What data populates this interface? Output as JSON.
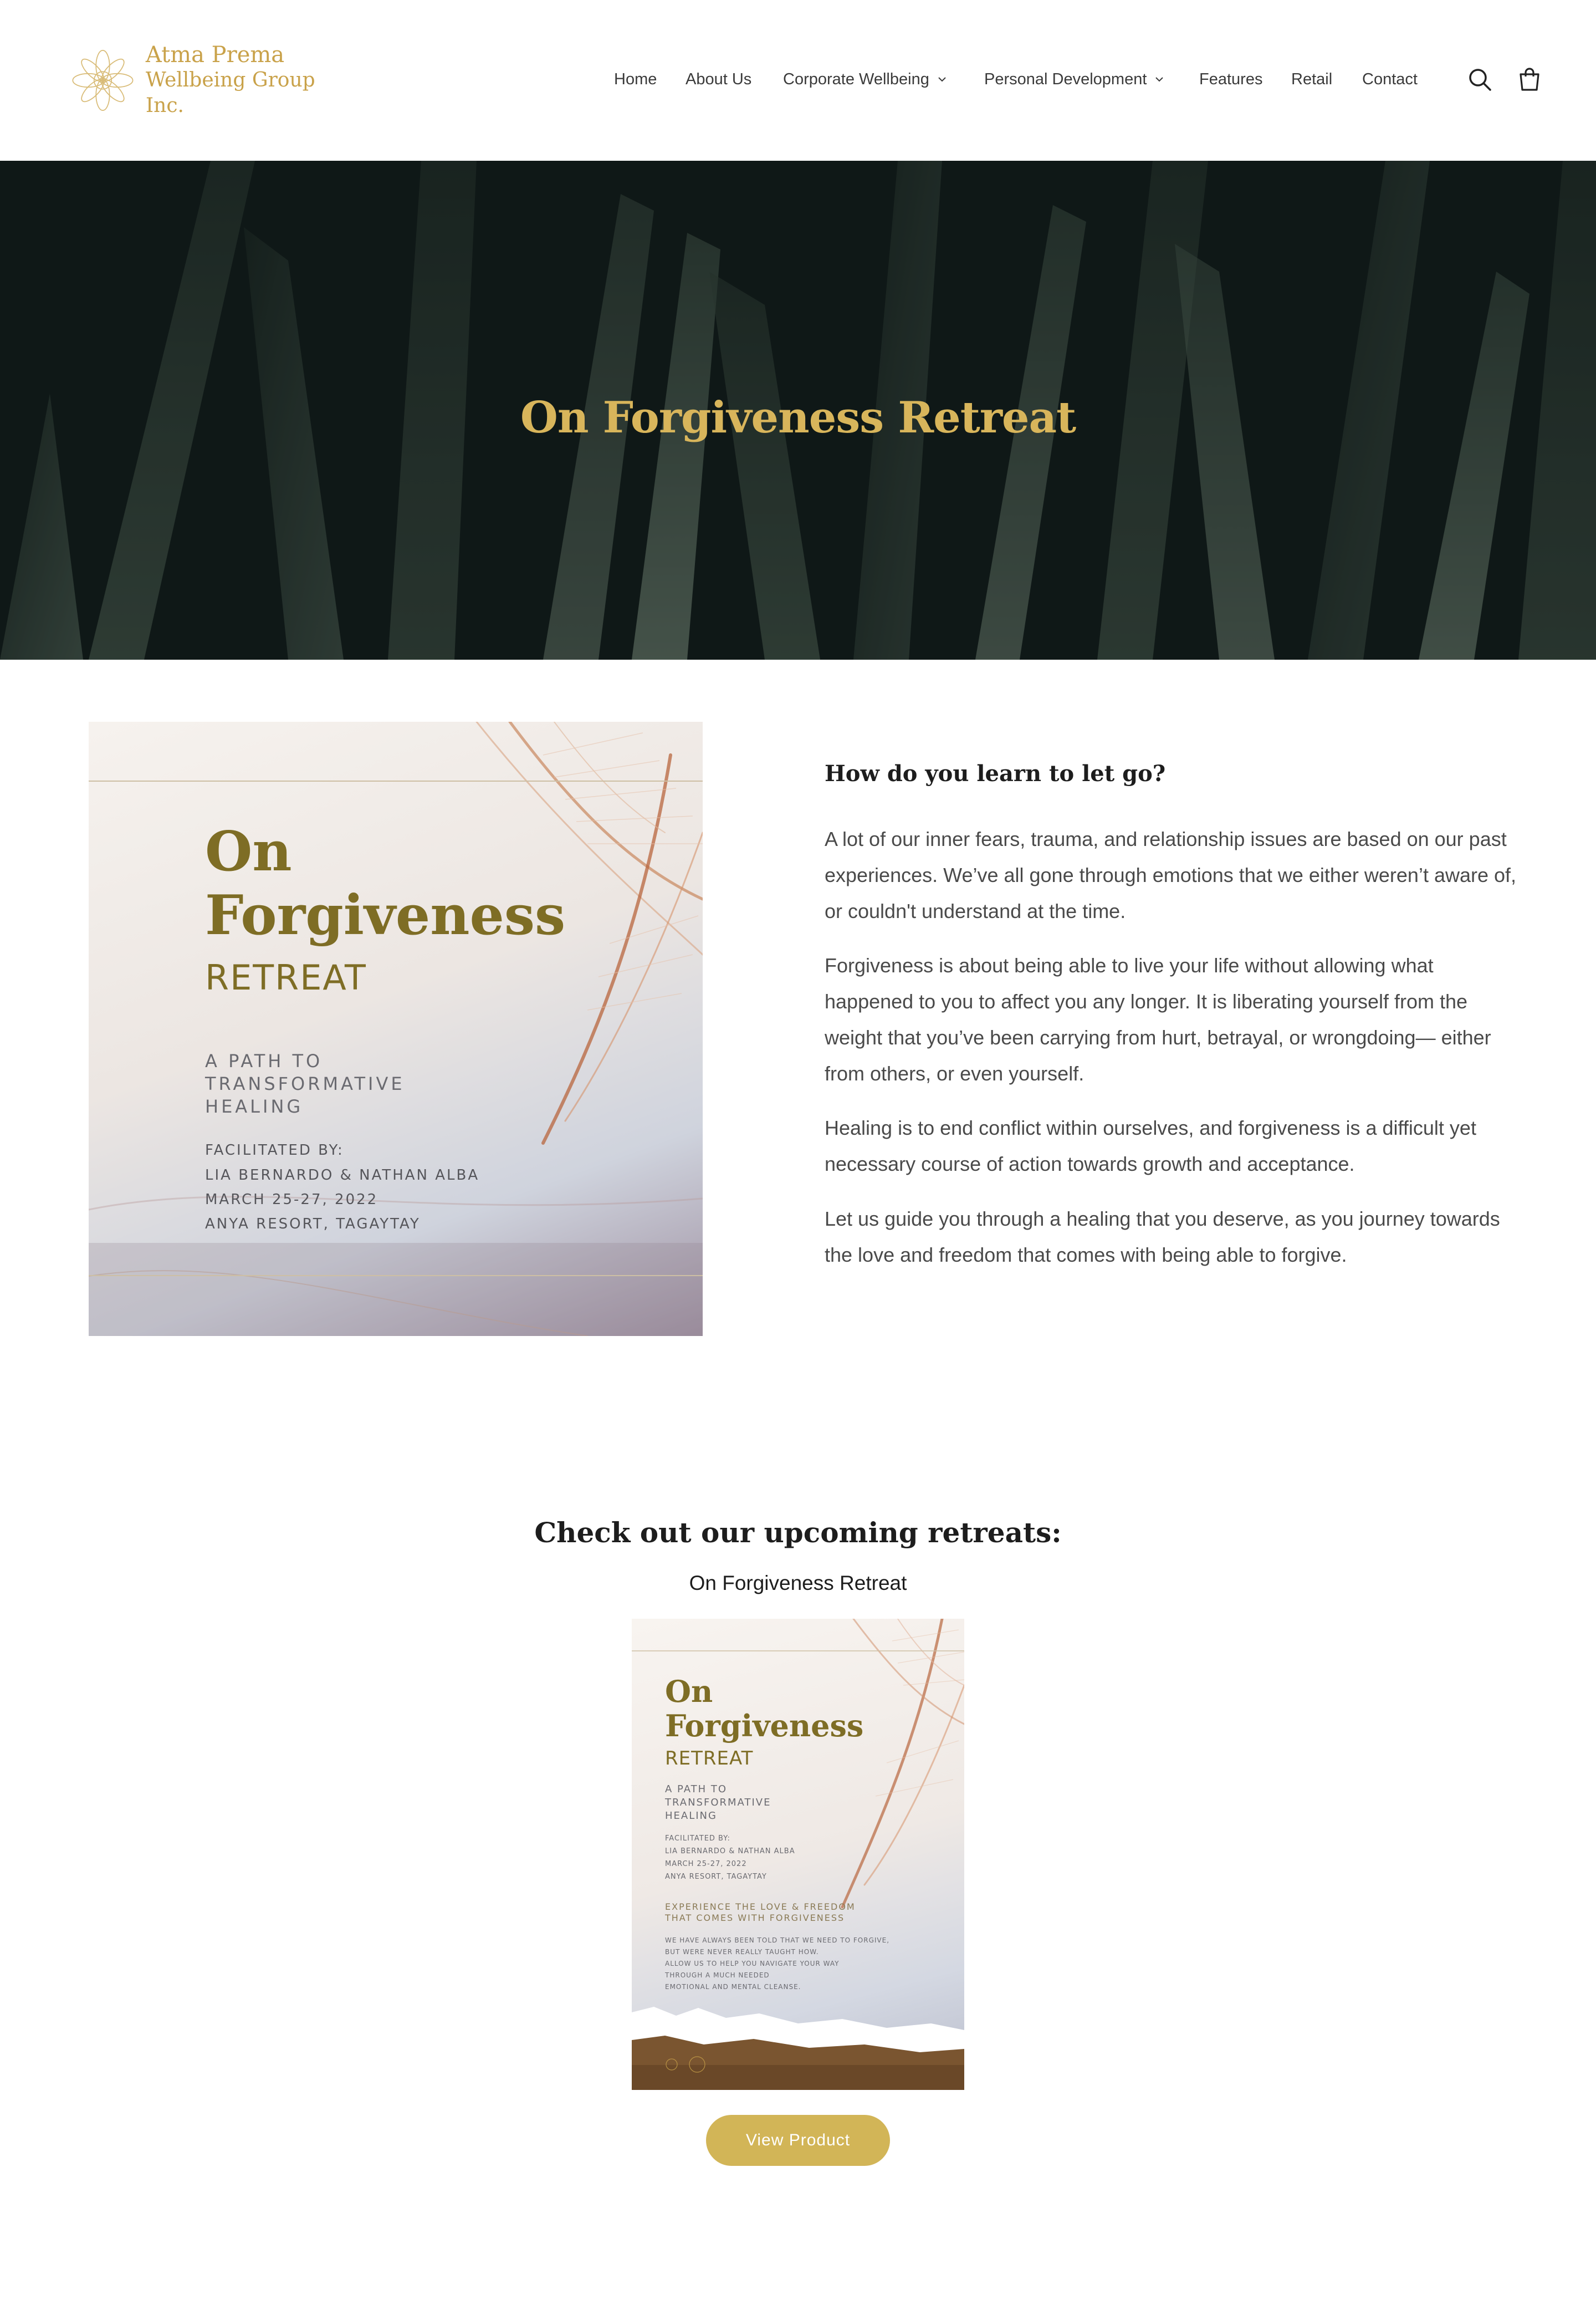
{
  "brand": {
    "name_line1": "Atma Prema",
    "name_line2": "Wellbeing Group Inc.",
    "accent_color": "#d2b557",
    "logo_icon": "mandala-flower-icon"
  },
  "nav": {
    "items": [
      {
        "label": "Home"
      },
      {
        "label": "About Us"
      },
      {
        "label": "Corporate Wellbeing",
        "has_dropdown": true
      },
      {
        "label": "Personal Development",
        "has_dropdown": true
      },
      {
        "label": "Features"
      },
      {
        "label": "Retail"
      },
      {
        "label": "Contact"
      }
    ],
    "icons": [
      "search-icon",
      "cart-icon"
    ]
  },
  "hero": {
    "title": "On Forgiveness Retreat",
    "background": "dark green grass blades"
  },
  "poster": {
    "title_line1": "On",
    "title_line2": "Forgiveness",
    "subtitle": "RETREAT",
    "tagline_line1": "A PATH TO",
    "tagline_line2": "TRANSFORMATIVE",
    "tagline_line3": "HEALING",
    "facilitated_label": "FACILITATED BY:",
    "facilitators": "LIA BERNARDO & NATHAN ALBA",
    "dates": "MARCH 25-27, 2022",
    "venue": "ANYA RESORT, TAGAYTAY"
  },
  "intro": {
    "heading": "How do you learn to let go?",
    "paragraphs": [
      "A lot of our inner fears, trauma, and relationship issues are based on our past experiences. We’ve all gone through emotions that we either weren’t aware of, or couldn't understand at the time.",
      "Forgiveness is about being able to live your life without allowing what happened to you to affect you any longer. It is liberating yourself from the weight that you’ve been carrying from hurt, betrayal, or wrongdoing— either from others, or even yourself.",
      "Healing is to end conflict within ourselves, and forgiveness is a difficult yet necessary course of action towards growth and acceptance.",
      "Let us guide you through a healing that you deserve, as you journey towards the love and freedom that comes with being able to forgive."
    ]
  },
  "upcoming": {
    "heading": "Check out our upcoming retreats:",
    "product_title": "On Forgiveness Retreat",
    "button_label": "View Product",
    "poster_extra_line1": "EXPERIENCE THE LOVE & FREEDOM",
    "poster_extra_line2": "THAT COMES WITH FORGIVENESS",
    "poster_body": [
      "WE HAVE ALWAYS BEEN TOLD THAT WE NEED TO FORGIVE,",
      "BUT WERE NEVER REALLY TAUGHT HOW.",
      "ALLOW US TO HELP YOU NAVIGATE YOUR WAY",
      "THROUGH A MUCH NEEDED",
      "EMOTIONAL AND MENTAL CLEANSE."
    ]
  }
}
